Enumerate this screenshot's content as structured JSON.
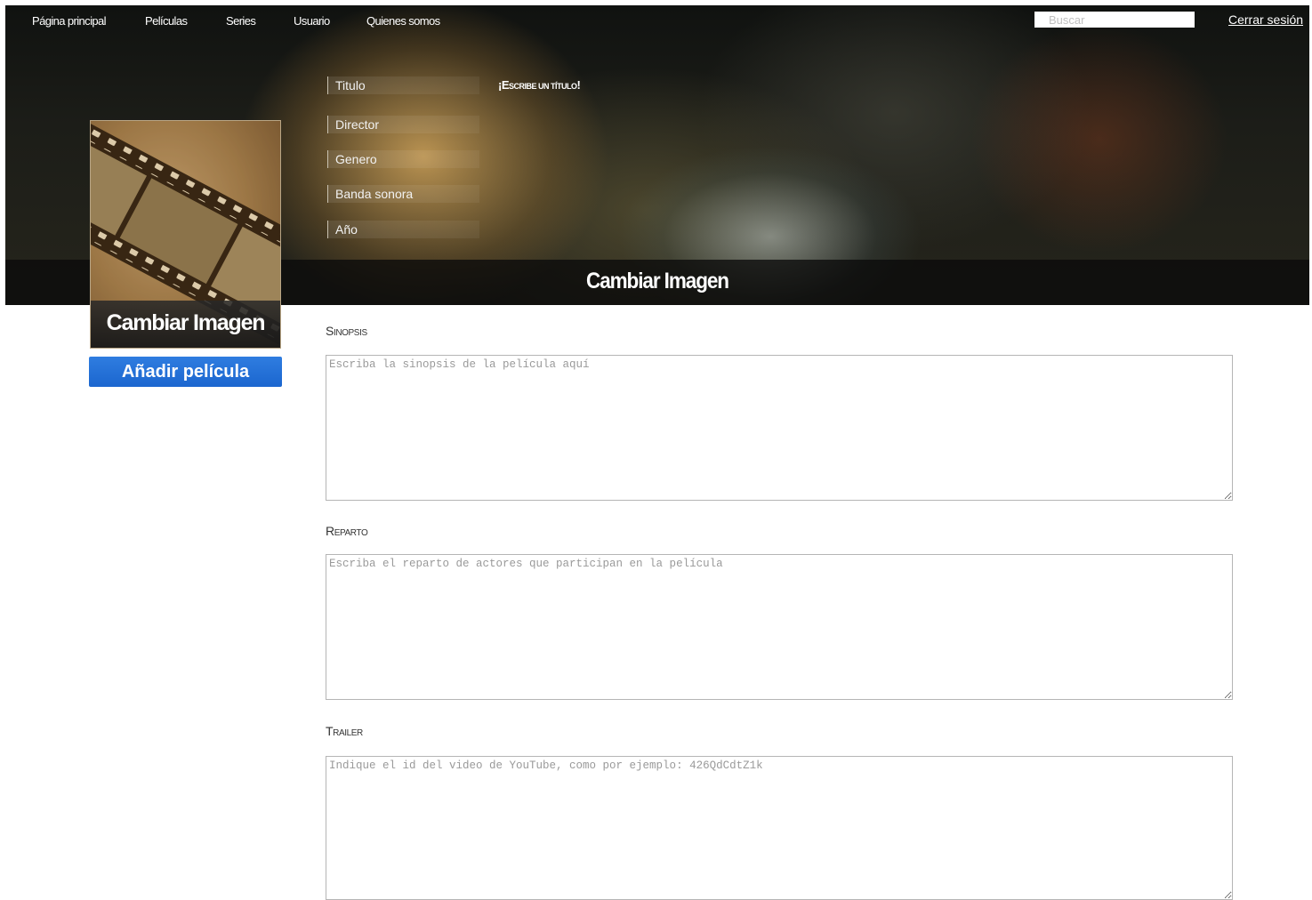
{
  "nav": {
    "items": [
      {
        "label": "Página principal"
      },
      {
        "label": "Películas"
      },
      {
        "label": "Series"
      },
      {
        "label": "Usuario"
      },
      {
        "label": "Quienes somos"
      }
    ],
    "search_placeholder": "Buscar",
    "logout_label": "Cerrar sesión"
  },
  "hero": {
    "fields": {
      "title": "Titulo",
      "director": "Director",
      "genre": "Genero",
      "soundtrack": "Banda sonora",
      "year": "Año"
    },
    "title_prompt": {
      "first": "¡E",
      "rest": "SCRIBE UN TÍTULO",
      "end": "!"
    },
    "banner_label": "Cambiar Imagen"
  },
  "poster": {
    "caption": "Cambiar Imagen"
  },
  "add_button_label": "Añadir película",
  "sections": {
    "synopsis": {
      "cap": "S",
      "rest": "INOPSIS",
      "placeholder": "Escriba la sinopsis de la película aquí"
    },
    "cast": {
      "cap": "R",
      "rest": "EPARTO",
      "placeholder": "Escriba el reparto de actores que participan en la película"
    },
    "trailer": {
      "cap": "T",
      "rest": "RAILER",
      "placeholder": "Indique el id del video de YouTube, como por ejemplo: 426QdCdtZ1k"
    }
  },
  "colors": {
    "button_blue": "#1b66cf",
    "header_dark": "#101210",
    "text_white": "#ffffff"
  }
}
